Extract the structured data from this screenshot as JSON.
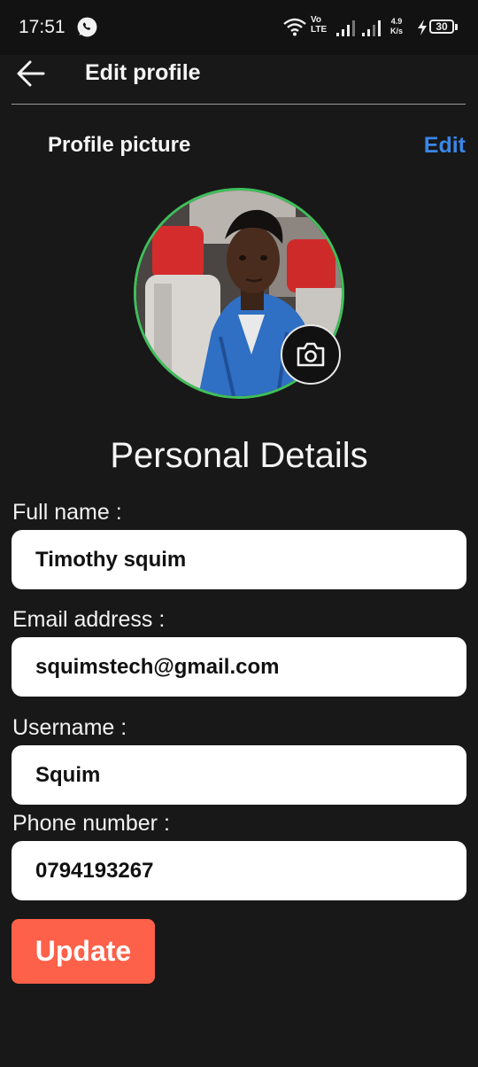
{
  "status_bar": {
    "time": "17:51",
    "network_line1": "Vo",
    "network_line2": "LTE",
    "speed_value": "4.9",
    "speed_unit": "K/s",
    "battery": "30",
    "icons": [
      "whatsapp-icon",
      "wifi-icon",
      "signal-icon",
      "charging-icon",
      "battery-icon"
    ]
  },
  "app_bar": {
    "title": "Edit profile",
    "back_icon": "arrow-left-icon"
  },
  "profile_picture": {
    "label": "Profile picture",
    "edit_label": "Edit",
    "camera_icon": "camera-icon"
  },
  "personal_details": {
    "heading": "Personal Details",
    "fields": [
      {
        "label": "Full name :",
        "value": "Timothy squim"
      },
      {
        "label": "Email address :",
        "value": "squimstech@gmail.com"
      },
      {
        "label": "Username :",
        "value": "Squim"
      },
      {
        "label": "Phone number :",
        "value": "0794193267"
      }
    ]
  },
  "update_label": "Update",
  "colors": {
    "background": "#181818",
    "edit_link": "#3a86e8",
    "update_button": "#fd6149",
    "avatar_ring": "#3fbf5a"
  }
}
